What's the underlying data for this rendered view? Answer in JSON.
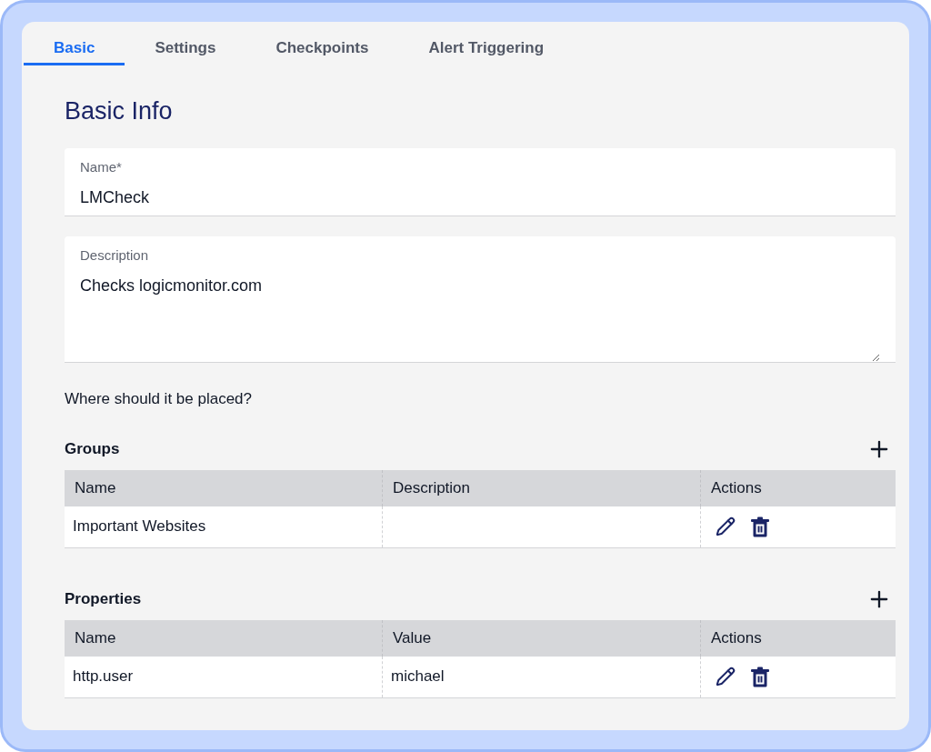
{
  "tabs": [
    {
      "label": "Basic",
      "selected": true
    },
    {
      "label": "Settings",
      "selected": false
    },
    {
      "label": "Checkpoints",
      "selected": false
    },
    {
      "label": "Alert Triggering",
      "selected": false
    }
  ],
  "heading": "Basic Info",
  "fields": [
    {
      "kind": "input",
      "label": "Name*",
      "value": "LMCheck"
    },
    {
      "kind": "textarea",
      "label": "Description",
      "value": "Checks logicmonitor.com"
    }
  ],
  "placement_prompt": "Where should it be placed?",
  "tables": [
    {
      "title": "Groups",
      "columns": [
        "Name",
        "Description",
        "Actions"
      ],
      "rows": [
        {
          "cells": [
            "Important Websites"
          ]
        }
      ]
    },
    {
      "title": "Properties",
      "columns": [
        "Name",
        "Value",
        "Actions"
      ],
      "rows": [
        {
          "cells": [
            "http.user",
            "michael"
          ]
        }
      ]
    }
  ]
}
